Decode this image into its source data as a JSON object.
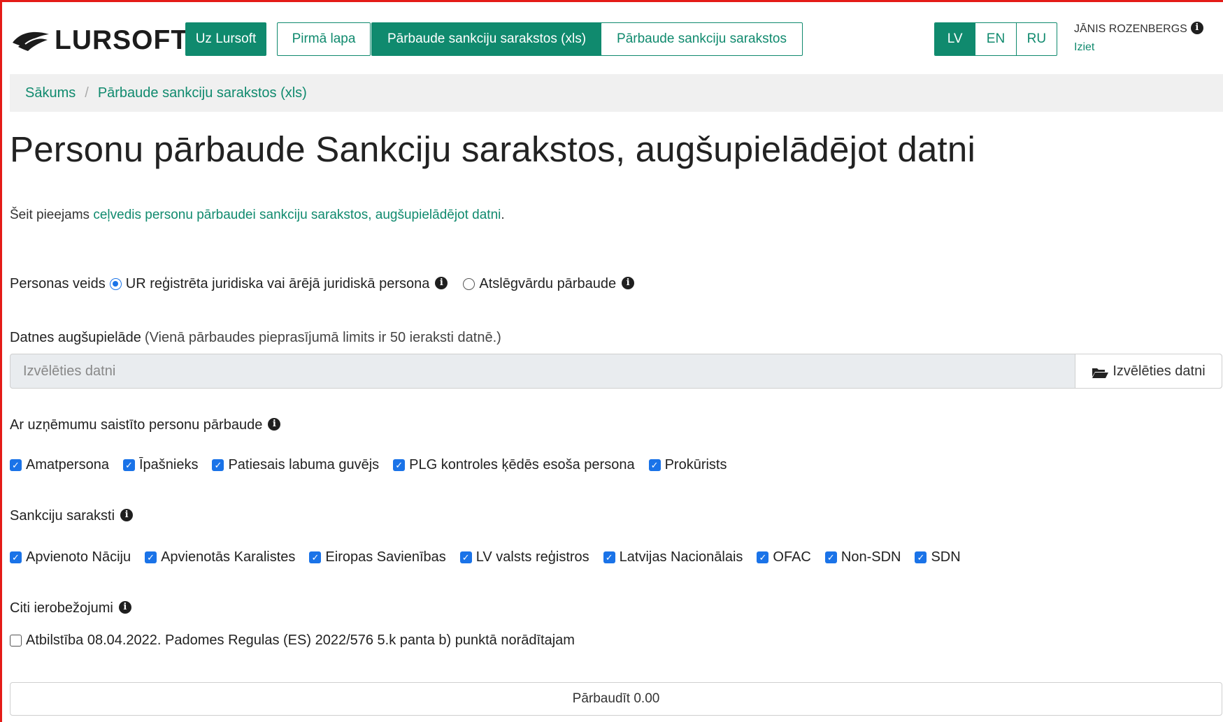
{
  "brand": {
    "name": "LURSOFT",
    "reg": "®"
  },
  "nav": {
    "about": "Uz Lursoft",
    "home": "Pirmā lapa",
    "xls_check": "Pārbaude sankciju sarakstos (xls)",
    "check": "Pārbaude sankciju sarakstos"
  },
  "languages": [
    "LV",
    "EN",
    "RU"
  ],
  "user": {
    "name": "JĀNIS ROZENBERGS",
    "logout": "Iziet"
  },
  "breadcrumb": {
    "home": "Sākums",
    "separator": "/",
    "current": "Pārbaude sankciju sarakstos (xls)"
  },
  "page_title": "Personu pārbaude Sankciju sarakstos, augšupielādējot datni",
  "intro": {
    "prefix": "Šeit pieejams ",
    "link": "ceļvedis personu pārbaudei sankciju sarakstos, augšupielādējot datni",
    "suffix": "."
  },
  "person_type": {
    "label": "Personas veids",
    "options": [
      {
        "label": "UR reģistrēta juridiska vai ārējā juridiskā persona",
        "selected": true
      },
      {
        "label": "Atslēgvārdu pārbaude",
        "selected": false
      }
    ]
  },
  "upload": {
    "label": "Datnes augšupielāde",
    "note": "(Vienā pārbaudes pieprasījumā limits ir 50 ieraksti datnē.)",
    "placeholder": "Izvēlēties datni",
    "button": "Izvēlēties datni"
  },
  "related": {
    "label": "Ar uzņēmumu saistīto personu pārbaude",
    "items": [
      "Amatpersona",
      "Īpašnieks",
      "Patiesais labuma guvējs",
      "PLG kontroles ķēdēs esoša persona",
      "Prokūrists"
    ]
  },
  "sanctions": {
    "label": "Sankciju saraksti",
    "items": [
      "Apvienoto Nāciju",
      "Apvienotās Karalistes",
      "Eiropas Savienības",
      "LV valsts reģistros",
      "Latvijas Nacionālais",
      "OFAC",
      "Non-SDN",
      "SDN"
    ]
  },
  "other": {
    "label": "Citi ierobežojumi",
    "item": "Atbilstība 08.04.2022. Padomes Regulas (ES) 2022/576 5.k panta b) punktā norādītajam",
    "checked": false
  },
  "submit": "Pārbaudīt 0.00",
  "colors": {
    "accent": "#108a6e",
    "checkbox": "#1a73e8",
    "frame": "#e41b17"
  },
  "icons": {
    "info": "info-circle-icon",
    "folder": "folder-open-icon",
    "logo": "lursoft-leaf-icon"
  }
}
